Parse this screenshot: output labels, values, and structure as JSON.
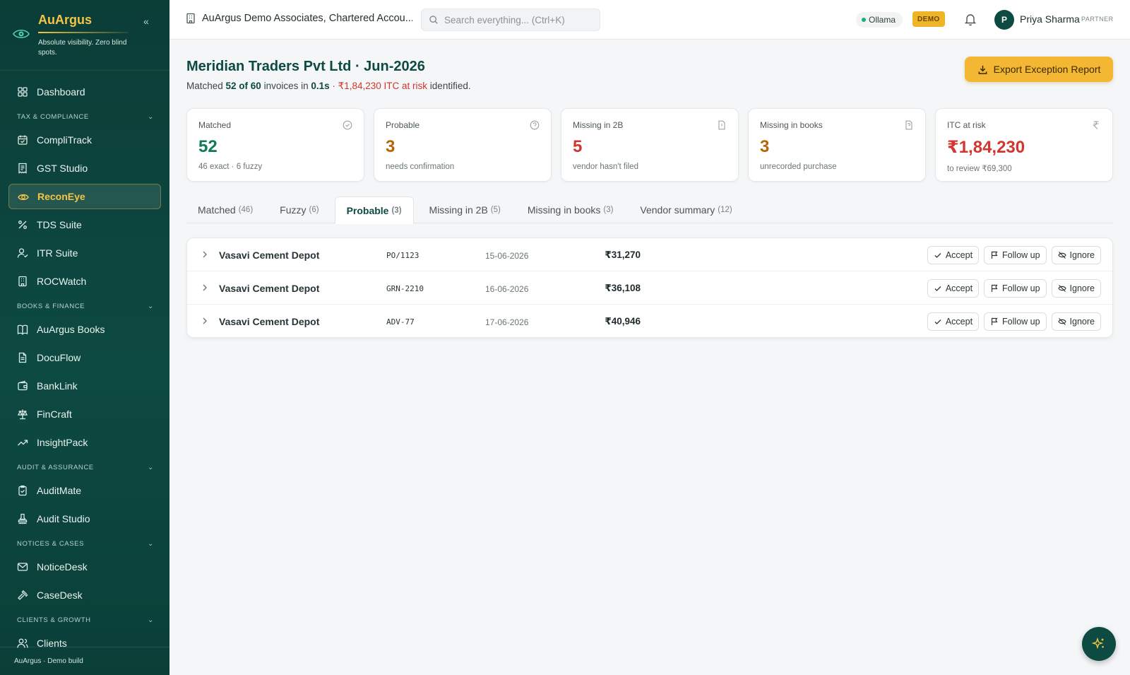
{
  "brand": {
    "name": "AuArgus",
    "tagline": "Absolute visibility. Zero blind spots."
  },
  "sidebar": {
    "top_item": {
      "label": "Dashboard",
      "icon": "grid-icon"
    },
    "sections": [
      {
        "title": "TAX & COMPLIANCE",
        "items": [
          {
            "label": "CompliTrack",
            "icon": "calendar-check-icon"
          },
          {
            "label": "GST Studio",
            "icon": "receipt-icon"
          },
          {
            "label": "ReconEye",
            "icon": "eye-icon",
            "active": true
          },
          {
            "label": "TDS Suite",
            "icon": "percent-icon"
          },
          {
            "label": "ITR Suite",
            "icon": "user-check-icon"
          },
          {
            "label": "ROCWatch",
            "icon": "building-icon"
          }
        ]
      },
      {
        "title": "BOOKS & FINANCE",
        "items": [
          {
            "label": "AuArgus Books",
            "icon": "book-icon"
          },
          {
            "label": "DocuFlow",
            "icon": "document-icon"
          },
          {
            "label": "BankLink",
            "icon": "wallet-icon"
          },
          {
            "label": "FinCraft",
            "icon": "scale-icon"
          },
          {
            "label": "InsightPack",
            "icon": "trend-icon"
          }
        ]
      },
      {
        "title": "AUDIT & ASSURANCE",
        "items": [
          {
            "label": "AuditMate",
            "icon": "clipboard-icon"
          },
          {
            "label": "Audit Studio",
            "icon": "stamp-icon"
          }
        ]
      },
      {
        "title": "NOTICES & CASES",
        "items": [
          {
            "label": "NoticeDesk",
            "icon": "mail-icon"
          },
          {
            "label": "CaseDesk",
            "icon": "gavel-icon"
          }
        ]
      },
      {
        "title": "CLIENTS & GROWTH",
        "items": [
          {
            "label": "Clients",
            "icon": "users-icon"
          }
        ]
      }
    ],
    "footer": "AuArgus · Demo build"
  },
  "header": {
    "org": "AuArgus Demo Associates, Chartered Accou...",
    "search_placeholder": "Search everything... (Ctrl+K)",
    "ollama": "Ollama",
    "demo": "DEMO",
    "user_initial": "P",
    "user_name": "Priya Sharma",
    "user_role": "PARTNER"
  },
  "page": {
    "title": "Meridian Traders Pvt Ltd · Jun-2026",
    "sub_prefix": "Matched ",
    "sub_matched": "52 of 60",
    "sub_mid": " invoices in ",
    "sub_time": "0.1s",
    "sub_dash": " · ",
    "sub_risk": "₹1,84,230 ITC at risk",
    "sub_suffix": " identified.",
    "export_label": "Export Exception Report"
  },
  "cards": [
    {
      "label": "Matched",
      "value": "52",
      "sub": "46 exact · 6 fuzzy",
      "icon": "check-circle-icon",
      "color": "#117a5b"
    },
    {
      "label": "Probable",
      "value": "3",
      "sub": "needs confirmation",
      "icon": "help-circle-icon",
      "color": "#b8640b"
    },
    {
      "label": "Missing in 2B",
      "value": "5",
      "sub": "vendor hasn't filed",
      "icon": "file-alert-icon",
      "color": "#d1362f"
    },
    {
      "label": "Missing in books",
      "value": "3",
      "sub": "unrecorded purchase",
      "icon": "file-question-icon",
      "color": "#b8640b"
    },
    {
      "label": "ITC at risk",
      "value": "₹1,84,230",
      "sub": "to review ₹69,300",
      "icon": "rupee-icon",
      "color": "#d1362f"
    }
  ],
  "tabs": [
    {
      "label": "Matched",
      "count": "(46)"
    },
    {
      "label": "Fuzzy",
      "count": "(6)"
    },
    {
      "label": "Probable",
      "count": "(3)",
      "active": true
    },
    {
      "label": "Missing in 2B",
      "count": "(5)"
    },
    {
      "label": "Missing in books",
      "count": "(3)"
    },
    {
      "label": "Vendor summary",
      "count": "(12)"
    }
  ],
  "rows": [
    {
      "vendor": "Vasavi Cement Depot",
      "ref": "PO/1123",
      "date": "15-06-2026",
      "amount": "₹31,270"
    },
    {
      "vendor": "Vasavi Cement Depot",
      "ref": "GRN-2210",
      "date": "16-06-2026",
      "amount": "₹36,108"
    },
    {
      "vendor": "Vasavi Cement Depot",
      "ref": "ADV-77",
      "date": "17-06-2026",
      "amount": "₹40,946"
    }
  ],
  "actions": {
    "accept": "Accept",
    "follow": "Follow up",
    "ignore": "Ignore"
  }
}
